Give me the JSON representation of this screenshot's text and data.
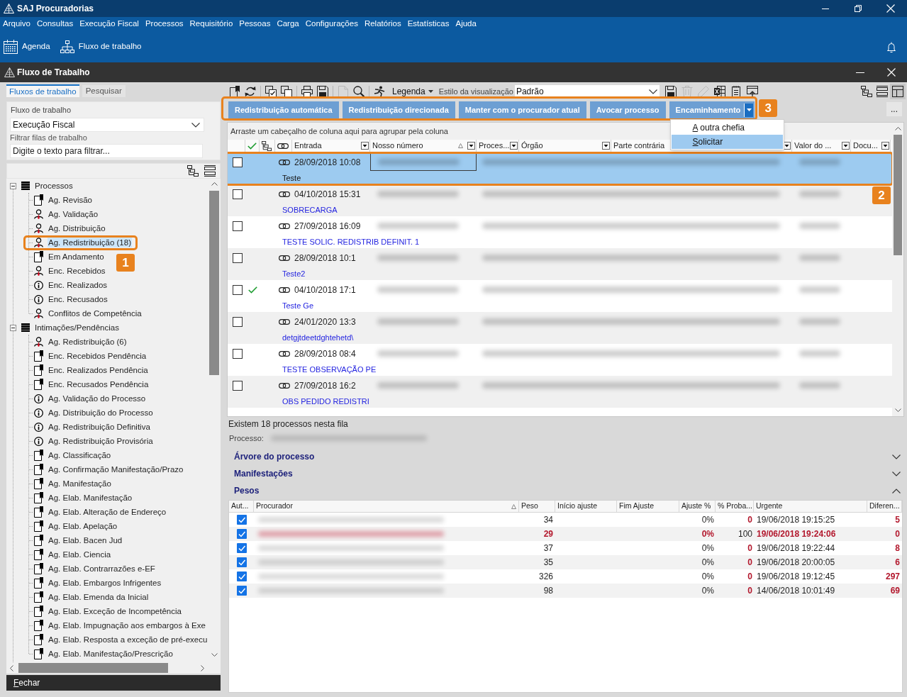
{
  "app": {
    "title": "SAJ Procuradorias"
  },
  "menu": [
    "Arquivo",
    "Consultas",
    "Execução Fiscal",
    "Processos",
    "Requisitório",
    "Pessoas",
    "Carga",
    "Configurações",
    "Relatórios",
    "Estatísticas",
    "Ajuda"
  ],
  "shortcuts": [
    {
      "kind": "calendar",
      "label": "Agenda"
    },
    {
      "kind": "hierarchy",
      "label": "Fluxo de trabalho"
    }
  ],
  "window": {
    "title": "Fluxo de Trabalho"
  },
  "sidebar": {
    "tabs": [
      {
        "label": "Fluxos de trabalho",
        "selected": true
      },
      {
        "label": "Pesquisar",
        "selected": false
      }
    ],
    "workflow": {
      "label": "Fluxo de trabalho",
      "value": "Execução Fiscal"
    },
    "filter": {
      "label": "Filtrar filas de trabalho",
      "placeholder": "Digite o texto para filtrar..."
    },
    "tree": [
      {
        "label": "Processos",
        "kind": "group",
        "expanded": true,
        "selected": false,
        "children": [
          {
            "label": "Ag. Revisão",
            "kind": "bookmark",
            "selected": false
          },
          {
            "label": "Ag. Validação",
            "kind": "person",
            "selected": false
          },
          {
            "label": "Ag. Distribuição",
            "kind": "person",
            "selected": false
          },
          {
            "label": "Ag. Redistribuição (18)",
            "kind": "person",
            "selected": true,
            "annotation": "1"
          },
          {
            "label": "Em Andamento",
            "kind": "bookmark",
            "selected": false
          },
          {
            "label": "Enc. Recebidos",
            "kind": "person",
            "selected": false
          },
          {
            "label": "Enc. Realizados",
            "kind": "info",
            "selected": false
          },
          {
            "label": "Enc. Recusados",
            "kind": "info",
            "selected": false
          },
          {
            "label": "Conflitos de Competência",
            "kind": "person",
            "selected": false
          }
        ]
      },
      {
        "label": "Intimações/Pendências",
        "kind": "group",
        "expanded": true,
        "selected": false,
        "children": [
          {
            "label": "Ag. Redistribuição (6)",
            "kind": "person",
            "selected": false
          },
          {
            "label": "Enc. Recebidos Pendência",
            "kind": "bookmark",
            "selected": false
          },
          {
            "label": "Enc. Realizados Pendência",
            "kind": "bookmark",
            "selected": false
          },
          {
            "label": "Enc. Recusados Pendência",
            "kind": "bookmark",
            "selected": false
          },
          {
            "label": "Ag. Validação do Processo",
            "kind": "info",
            "selected": false
          },
          {
            "label": "Ag. Distribuição do Processo",
            "kind": "info",
            "selected": false
          },
          {
            "label": "Ag. Redistribuição Definitiva",
            "kind": "info",
            "selected": false
          },
          {
            "label": "Ag. Redistribuição Provisória",
            "kind": "info",
            "selected": false
          },
          {
            "label": "Ag. Classificação",
            "kind": "bookmark",
            "selected": false
          },
          {
            "label": "Ag. Confirmação Manifestação/Prazo",
            "kind": "bookmark",
            "selected": false
          },
          {
            "label": "Ag. Manifestação",
            "kind": "bookmark",
            "selected": false
          },
          {
            "label": "Ag. Elab. Manifestação",
            "kind": "bookmark",
            "selected": false
          },
          {
            "label": "Ag. Elab. Alteração de Endereço",
            "kind": "bookmark",
            "selected": false
          },
          {
            "label": "Ag. Elab. Apelação",
            "kind": "bookmark",
            "selected": false
          },
          {
            "label": "Ag. Elab. Bacen Jud",
            "kind": "bookmark",
            "selected": false
          },
          {
            "label": "Ag. Elab. Ciencia",
            "kind": "bookmark",
            "selected": false
          },
          {
            "label": "Ag. Elab. Contrarrazões e-EF",
            "kind": "bookmark",
            "selected": false
          },
          {
            "label": "Ag. Elab. Embargos Infrigentes",
            "kind": "bookmark",
            "selected": false
          },
          {
            "label": "Ag. Elab. Emenda da Inicial",
            "kind": "bookmark",
            "selected": false
          },
          {
            "label": "Ag. Elab. Exceção de Incompetência",
            "kind": "bookmark",
            "selected": false
          },
          {
            "label": "Ag. Elab. Impugnação aos embargos à Exe",
            "kind": "bookmark",
            "selected": false
          },
          {
            "label": "Ag. Elab. Resposta a exceção de pré-execu",
            "kind": "bookmark",
            "selected": false
          },
          {
            "label": "Ag. Elab. Manifestação/Prescrição",
            "kind": "bookmark",
            "selected": false
          }
        ]
      }
    ],
    "close_button": "Fechar"
  },
  "toolbar": {
    "tools": [
      {
        "kind": "bookmark",
        "disabled": false
      },
      {
        "kind": "refresh",
        "disabled": false
      },
      {
        "kind": "checklist",
        "disabled": false
      },
      {
        "kind": "copy",
        "disabled": false
      },
      {
        "kind": "print",
        "disabled": false
      },
      {
        "kind": "save",
        "disabled": false
      },
      {
        "kind": "document",
        "disabled": true
      },
      {
        "kind": "search",
        "disabled": false
      },
      {
        "kind": "walker",
        "disabled": false
      }
    ],
    "legend": "Legenda",
    "style_label": "Estilo da visualização",
    "style_value": "Padrão",
    "tools_after": [
      {
        "kind": "save",
        "disabled": false
      },
      {
        "kind": "trash",
        "disabled": true
      },
      {
        "kind": "pencil",
        "disabled": true
      },
      {
        "kind": "spreadsheet",
        "disabled": false
      },
      {
        "kind": "notepad",
        "disabled": false
      },
      {
        "kind": "window",
        "disabled": false
      }
    ],
    "view_tools": [
      {
        "kind": "hierarchy",
        "selected": false
      },
      {
        "kind": "collapse",
        "selected": false
      },
      {
        "kind": "preview",
        "selected": true
      }
    ]
  },
  "actions": {
    "annotation": "3",
    "buttons": [
      {
        "kind": "button",
        "label": "Redistribuição automática"
      },
      {
        "kind": "button",
        "label": "Redistribuição direcionada"
      },
      {
        "kind": "button",
        "label": "Manter com o procurador atual"
      },
      {
        "kind": "button",
        "label": "Avocar processo"
      },
      {
        "kind": "split",
        "label": "Encaminhamento",
        "open": true,
        "menu": [
          {
            "label": "A outra chefia",
            "selected": false
          },
          {
            "label": "Solicitar",
            "selected": true
          }
        ]
      }
    ],
    "more_button": "..."
  },
  "grid": {
    "group_hint": "Arraste um cabeçalho de coluna aqui para agrupar pela coluna",
    "columns": [
      {
        "kind": "select"
      },
      {
        "kind": "check"
      },
      {
        "kind": "tree"
      },
      {
        "kind": "link"
      },
      {
        "kind": "text",
        "label": "Entrada",
        "sorted": false
      },
      {
        "kind": "text",
        "label": "Nosso número",
        "sorted": true
      },
      {
        "kind": "text",
        "label": "Proces...",
        "sorted": false
      },
      {
        "kind": "text",
        "label": "Órgão",
        "sorted": false
      },
      {
        "kind": "text",
        "label": "Parte contrária",
        "sorted": false
      },
      {
        "kind": "text",
        "label": "Valor do ...",
        "sorted": false
      },
      {
        "kind": "text",
        "label": "Docu...",
        "sorted": false
      }
    ],
    "rows": [
      {
        "selected": true,
        "checked": false,
        "validated": false,
        "entry": "28/09/2018 10:08",
        "note": "Teste",
        "annotation": "2"
      },
      {
        "selected": false,
        "checked": false,
        "validated": false,
        "entry": "04/10/2018 15:31",
        "note": "SOBRECARGA"
      },
      {
        "selected": false,
        "checked": false,
        "validated": false,
        "entry": "27/09/2018 16:09",
        "note": "TESTE SOLIC. REDISTRIB DEFINIT. 1"
      },
      {
        "selected": false,
        "checked": false,
        "validated": false,
        "entry": "28/09/2018 10:1",
        "note": "Teste2"
      },
      {
        "selected": false,
        "checked": false,
        "validated": true,
        "entry": "04/10/2018 17:1",
        "note": "Teste Ge"
      },
      {
        "selected": false,
        "checked": false,
        "validated": false,
        "entry": "24/01/2020 13:3",
        "note": "detgjtdeetdghtehetd\\"
      },
      {
        "selected": false,
        "checked": false,
        "validated": false,
        "entry": "28/09/2018 08:4",
        "note": "TESTE OBSERVAÇÃO PE"
      },
      {
        "selected": false,
        "checked": false,
        "validated": false,
        "entry": "27/09/2018 16:2",
        "note": "OBS PEDIDO REDISTRI"
      }
    ],
    "status": "Existem 18 processos nesta fila"
  },
  "details": {
    "process_label": "Processo:",
    "sections": [
      {
        "title": "Árvore do processo",
        "expanded": false
      },
      {
        "title": "Manifestações",
        "expanded": false
      },
      {
        "title": "Pesos",
        "expanded": true,
        "table": {
          "columns": [
            {
              "label": "Aut...",
              "sorted": false
            },
            {
              "label": "Procurador",
              "sorted": true
            },
            {
              "label": "Peso",
              "sorted": false
            },
            {
              "label": "Início ajuste",
              "sorted": false
            },
            {
              "label": "Fim Ajuste",
              "sorted": false
            },
            {
              "label": "Ajuste %",
              "sorted": false
            },
            {
              "label": "% Proba...",
              "sorted": false
            },
            {
              "label": "Urgente",
              "sorted": false
            },
            {
              "label": "Diferen...",
              "sorted": false
            }
          ],
          "rows": [
            {
              "checked": true,
              "highlighted": false,
              "weight": "34",
              "adjustment": "0%",
              "probability": "0",
              "urgent": "19/06/2018 19:15:25",
              "difference": "5"
            },
            {
              "checked": true,
              "highlighted": true,
              "weight": "29",
              "adjustment": "0%",
              "probability": "100",
              "urgent": "19/06/2018 19:24:06",
              "difference": "0"
            },
            {
              "checked": true,
              "highlighted": false,
              "weight": "37",
              "adjustment": "0%",
              "probability": "0",
              "urgent": "19/06/2018 19:22:44",
              "difference": "8"
            },
            {
              "checked": true,
              "highlighted": false,
              "weight": "35",
              "adjustment": "0%",
              "probability": "0",
              "urgent": "19/06/2018 20:00:05",
              "difference": "6"
            },
            {
              "checked": true,
              "highlighted": false,
              "weight": "326",
              "adjustment": "0%",
              "probability": "0",
              "urgent": "19/06/2018 19:12:45",
              "difference": "297"
            },
            {
              "checked": true,
              "highlighted": false,
              "weight": "98",
              "adjustment": "0%",
              "probability": "0",
              "urgent": "14/06/2018 10:01:49",
              "difference": "69"
            }
          ]
        }
      }
    ]
  }
}
